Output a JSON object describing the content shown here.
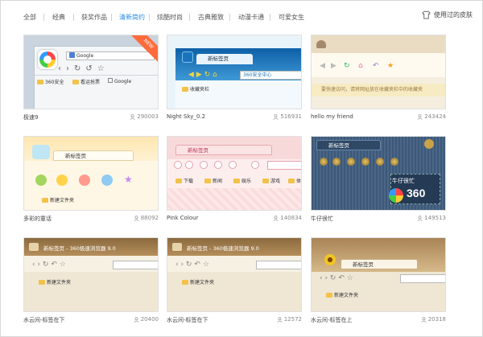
{
  "nav": {
    "tabs": [
      "全部",
      "经典",
      "获奖作品",
      "清新简约",
      "炫酷时尚",
      "古典雅致",
      "动漫卡通",
      "可爱女生"
    ],
    "active_index": 3,
    "used_skins_label": "使用过的皮肤"
  },
  "colors": {
    "accent": "#2b8ce3",
    "new_badge": "#ff6b3c"
  },
  "cards": [
    {
      "name": "极速9",
      "count": "290003",
      "badge": "NEW",
      "tab": "",
      "addr": "Google",
      "bookmarks": [
        "360安全",
        "看运抢票",
        "Google"
      ]
    },
    {
      "name": "Night Sky_0.2",
      "count": "516931",
      "tab": "新标签页",
      "addr": "360安全中心",
      "bookmarks": [
        "收藏夹栏"
      ]
    },
    {
      "name": "hello my friend",
      "count": "243424",
      "tab": "",
      "addr": "",
      "hint": "要快速访问，请将网址放在收藏夹栏中的收藏夹"
    },
    {
      "name": "多彩的童话",
      "count": "88092",
      "tab": "新标签页",
      "addr": "",
      "bookmarks": [
        "新建文件夹"
      ]
    },
    {
      "name": "Pink Colour",
      "count": "140834",
      "tab": "新标签页",
      "addr": "",
      "bookmarks": [
        "下载",
        "新闻",
        "娱乐",
        "游戏",
        "体育"
      ]
    },
    {
      "name": "牛仔很忙",
      "count": "149513",
      "tab": "新标签页",
      "addr": "",
      "logo_text": "牛仔很忙",
      "logo_num": "360"
    },
    {
      "name": "水云间-标签在下",
      "count": "20400",
      "tab": "新标签页 - 360极速浏览器 9.0",
      "addr": "",
      "bookmarks": [
        "新建文件夹"
      ]
    },
    {
      "name": "水云间-标签在下",
      "count": "12572",
      "tab": "新标签页 - 360极速浏览器 9.0",
      "addr": "",
      "bookmarks": [
        "新建文件夹"
      ]
    },
    {
      "name": "水云间-标签在上",
      "count": "20318",
      "tab": "新标签页",
      "addr": "",
      "bookmarks": [
        "新建文件夹"
      ]
    }
  ]
}
